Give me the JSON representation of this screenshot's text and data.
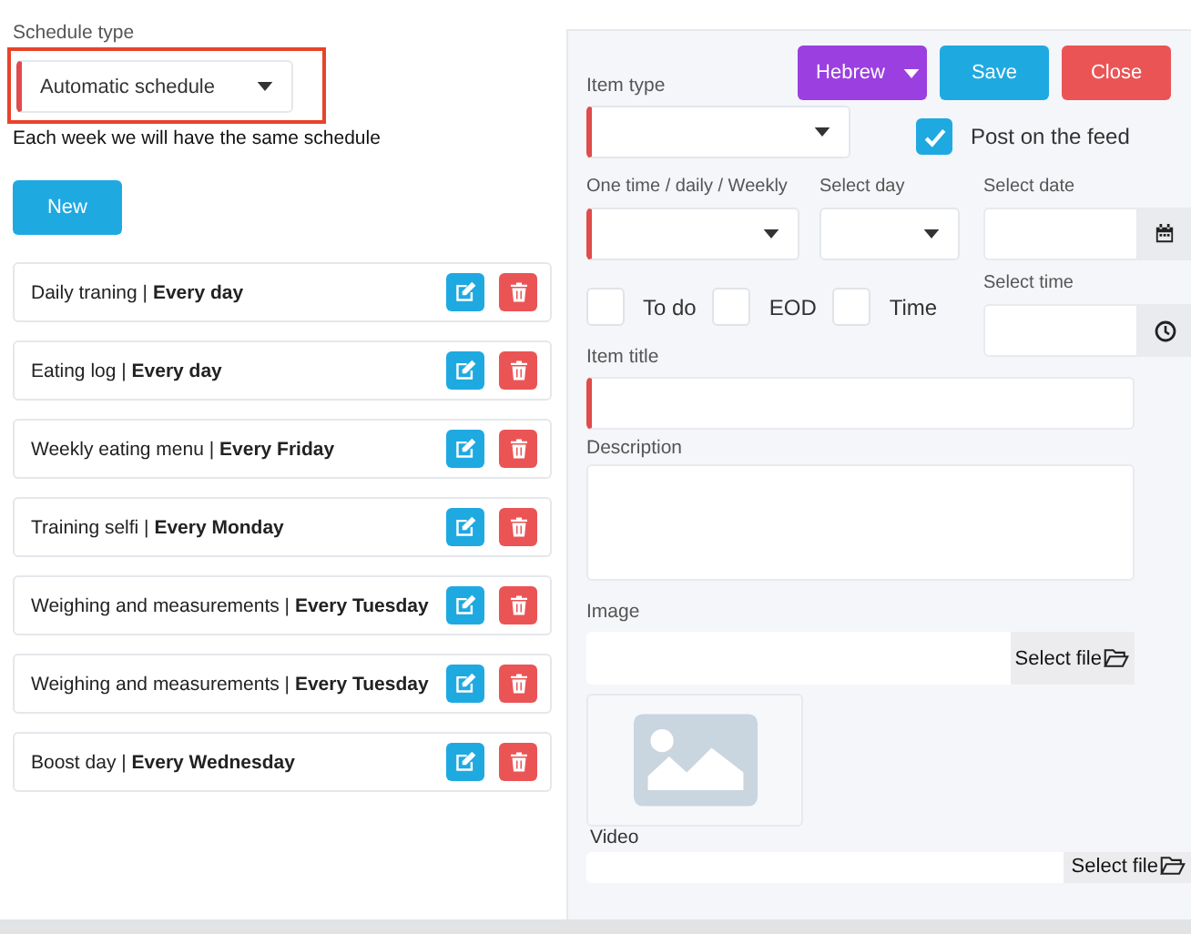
{
  "schedule_type": {
    "label": "Schedule type",
    "value": "Automatic schedule",
    "required": true,
    "highlighted": true,
    "note": "Each week we will have the same schedule"
  },
  "new_button": "New",
  "items": [
    {
      "text": "Daily traning | **Every day**"
    },
    {
      "text": "Eating log | **Every day**"
    },
    {
      "text": "Weekly eating menu | **Every Friday**"
    },
    {
      "text": "Training selfi | **Every Monday**"
    },
    {
      "text": "Weighing and measurements | **Every Tuesday**"
    },
    {
      "text": "Weighing and measurements | **Every Tuesday**"
    },
    {
      "text": "Boost day | **Every Wednesday**"
    }
  ],
  "editor": {
    "language": "Hebrew",
    "save": "Save",
    "close": "Close",
    "item_type": {
      "label": "Item type",
      "required": true
    },
    "post_on_feed": {
      "label": "Post on the feed",
      "checked": true
    },
    "frequency": {
      "label": "One time / daily / Weekly",
      "required": true
    },
    "select_day": {
      "label": "Select day",
      "required": false
    },
    "select_date": {
      "label": "Select date"
    },
    "select_time": {
      "label": "Select time"
    },
    "flags": [
      {
        "label": "To do",
        "checked": false
      },
      {
        "label": "EOD",
        "checked": false
      },
      {
        "label": "Time",
        "checked": false
      }
    ],
    "item_title": {
      "label": "Item title",
      "required": true
    },
    "description": {
      "label": "Description"
    },
    "image": {
      "label": "Image",
      "button": "Select file"
    },
    "video": {
      "label": "Video",
      "button": "Select file"
    }
  }
}
